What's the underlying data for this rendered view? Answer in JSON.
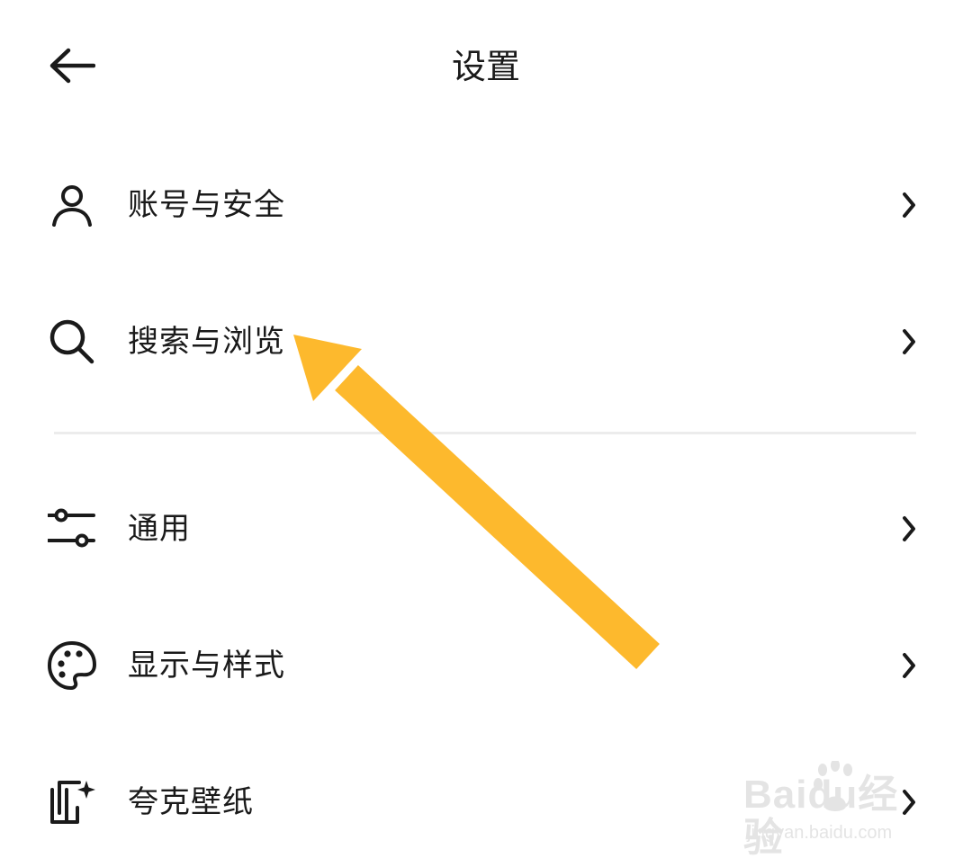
{
  "header": {
    "title": "设置",
    "back_icon": "arrow-left-icon"
  },
  "settings": {
    "items": [
      {
        "label": "账号与安全",
        "icon": "user-icon"
      },
      {
        "label": "搜索与浏览",
        "icon": "search-icon"
      },
      {
        "label": "通用",
        "icon": "sliders-icon"
      },
      {
        "label": "显示与样式",
        "icon": "palette-icon"
      },
      {
        "label": "夸克壁纸",
        "icon": "wallpaper-icon"
      }
    ]
  },
  "annotation": {
    "arrow_color": "#FDB92D",
    "points_to": "搜索与浏览"
  },
  "watermark": {
    "brand": "Baidu",
    "brand_cn": "经验",
    "url": "jingyan.baidu.com"
  },
  "colors": {
    "text": "#1a1a1a",
    "divider": "#ececec",
    "background": "#ffffff"
  }
}
